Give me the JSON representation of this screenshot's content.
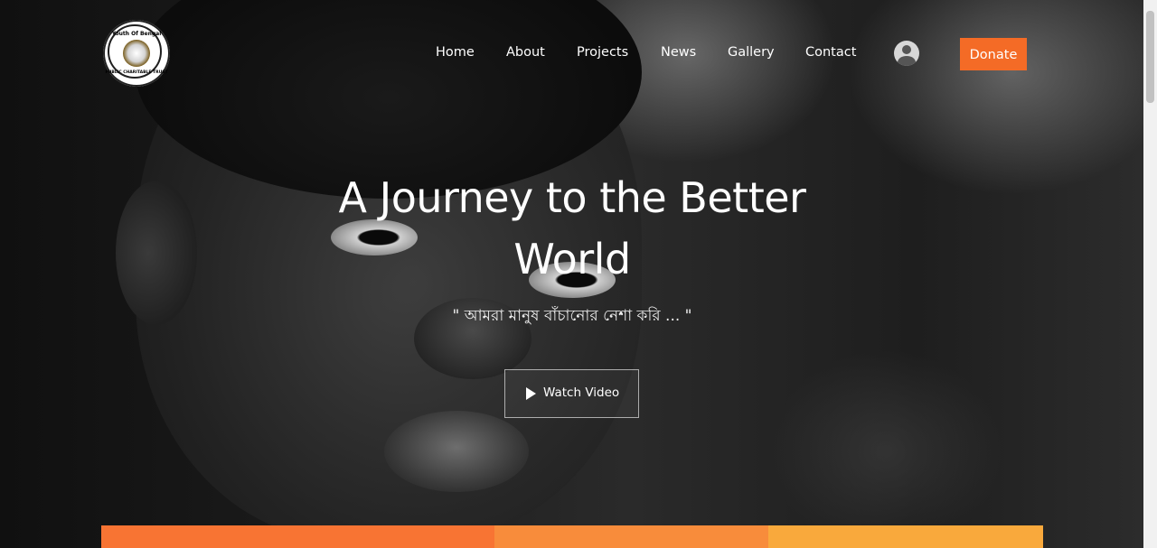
{
  "logo": {
    "top_text": "Youth Of Bengal",
    "bottom_text": "PUBLIC CHARITABLE TRUST"
  },
  "nav": {
    "items": [
      {
        "label": "Home"
      },
      {
        "label": "About"
      },
      {
        "label": "Projects"
      },
      {
        "label": "News"
      },
      {
        "label": "Gallery"
      },
      {
        "label": "Contact"
      }
    ],
    "profile_icon": "user-circle-icon",
    "donate_label": "Donate"
  },
  "hero": {
    "title_line1": "A Journey to the Better",
    "title_line2": "World",
    "tagline": "\" আমরা মানুষ বাঁচানোর নেশা করি ... \"",
    "watch_video_label": "Watch Video",
    "play_icon": "play-icon"
  },
  "colors": {
    "accent_orange": "#f46b26",
    "bar_orange_dark": "#f87433",
    "bar_orange_mid": "#f88c3b",
    "bar_orange_light": "#f9a93c"
  }
}
